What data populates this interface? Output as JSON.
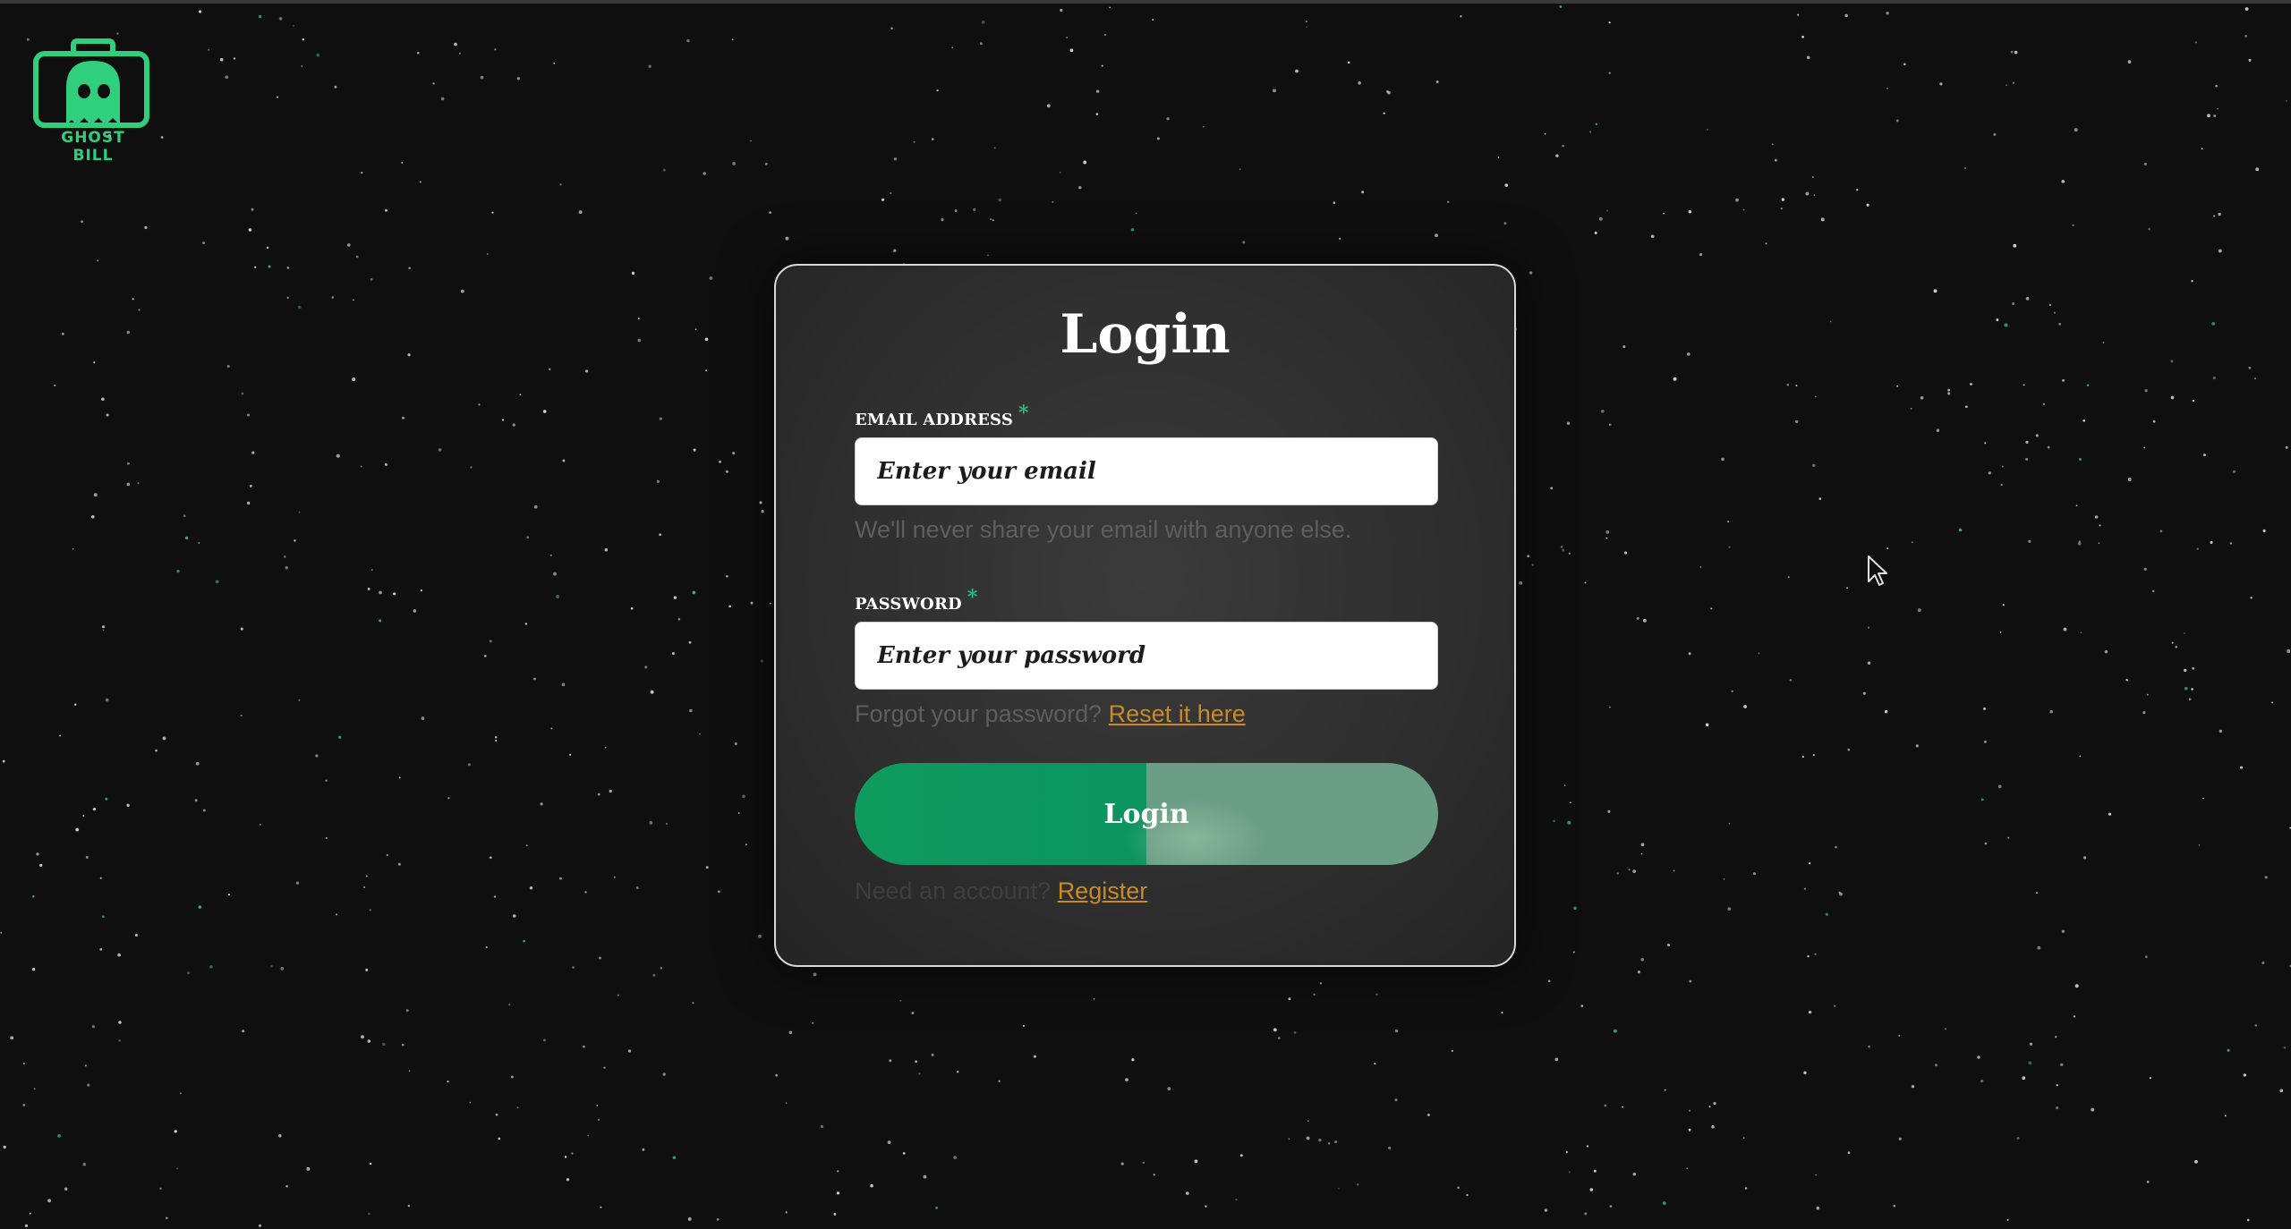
{
  "brand": {
    "name": "GHOST BILL",
    "accent_color": "#2fcf7d"
  },
  "login_form": {
    "title": "Login",
    "email": {
      "label": "EMAIL ADDRESS",
      "required_marker": "*",
      "placeholder": "Enter your email",
      "help_text": "We'll never share your email with anyone else."
    },
    "password": {
      "label": "PASSWORD",
      "required_marker": "*",
      "placeholder": "Enter your password",
      "forgot_text": "Forgot your password?",
      "reset_link": "Reset it here"
    },
    "submit_label": "Login",
    "register_prompt": "Need an account?",
    "register_link": "Register"
  },
  "colors": {
    "background": "#0f0f0f",
    "button_green": "#0f9a5e",
    "link": "#c98a23",
    "required_marker": "#2fb983"
  }
}
